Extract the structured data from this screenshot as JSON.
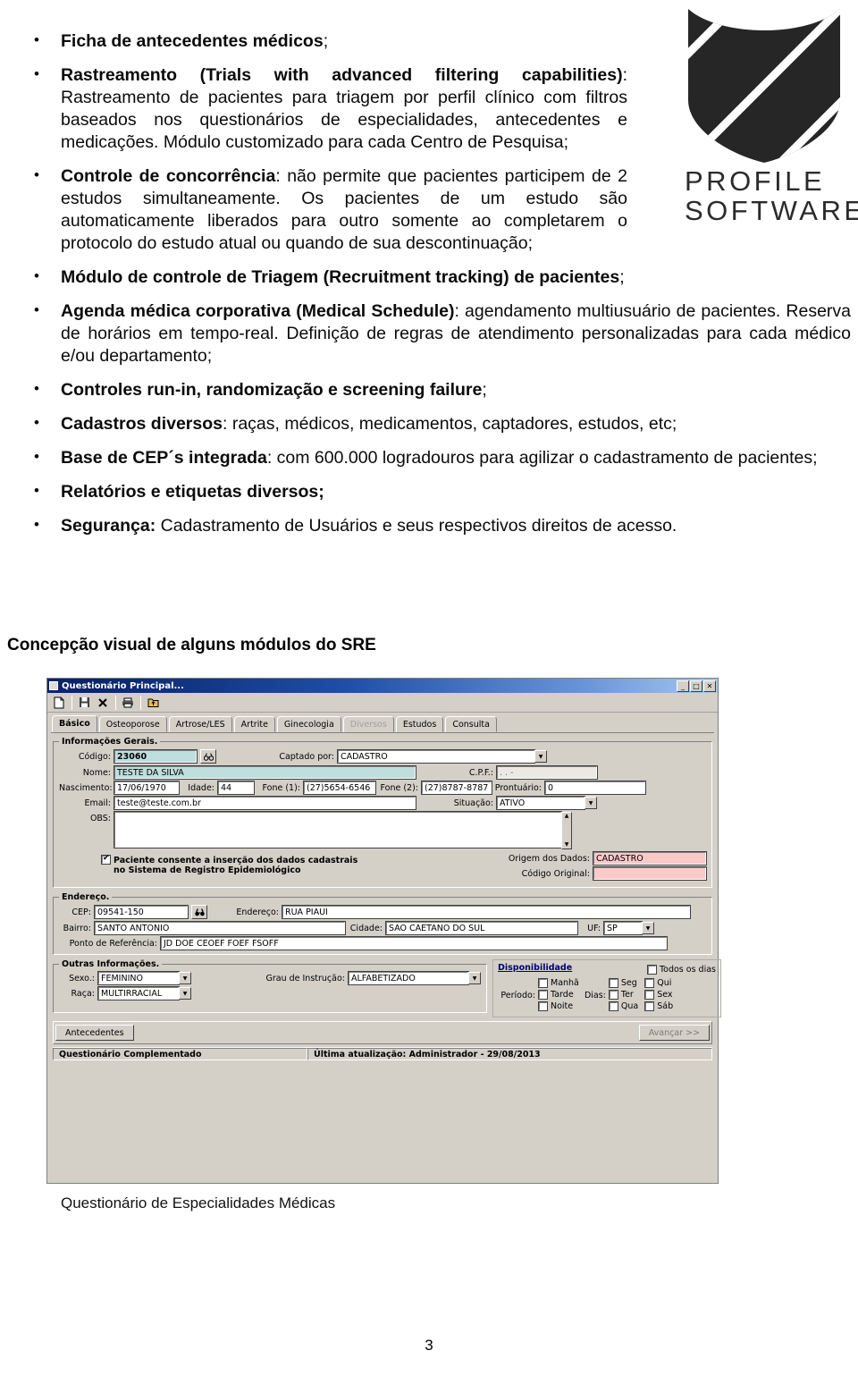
{
  "document": {
    "bullets": [
      {
        "id": "ficha-antecedentes",
        "bold": "Ficha de antecedentes médicos",
        "rest": ";"
      },
      {
        "id": "rastreamento",
        "bold": "Rastreamento (Trials with advanced filtering capabilities)",
        "rest": ": Rastreamento de pacientes para triagem por perfil clínico com filtros baseados nos questionários de especialidades, antecedentes e medicações. Módulo customizado para cada Centro de Pesquisa;"
      },
      {
        "id": "controle-concorrencia",
        "bold": "Controle de concorrência",
        "rest": ": não permite que pacientes participem de 2 estudos simultaneamente. Os pacientes de um estudo são automaticamente liberados para outro somente ao completarem o protocolo do estudo atual ou quando de sua descontinuação;"
      },
      {
        "id": "modulo-triagem",
        "bold": "Módulo de controle de Triagem (Recruitment tracking) de pacientes",
        "rest": ";"
      },
      {
        "id": "agenda-medica",
        "bold": "Agenda médica corporativa (Medical Schedule)",
        "rest": ": agendamento multiusuário de pacientes. Reserva de horários em tempo-real. Definição de regras de atendimento personalizadas para cada médico e/ou departamento;"
      },
      {
        "id": "controles-runin",
        "bold": "Controles run-in, randomização e screening failure",
        "rest": ";"
      },
      {
        "id": "cadastros-diversos",
        "bold": "Cadastros diversos",
        "rest": ": raças, médicos, medicamentos, captadores, estudos, etc;"
      },
      {
        "id": "base-ceps",
        "bold": "Base de CEP´s integrada",
        "rest": ": com 600.000 logradouros para agilizar o cadastramento de pacientes;"
      },
      {
        "id": "relatorios",
        "bold": "Relatórios e etiquetas diversos;",
        "rest": ""
      },
      {
        "id": "seguranca",
        "bold": "Segurança:",
        "rest": " Cadastramento de Usuários e seus respectivos direitos de acesso."
      }
    ],
    "section_heading": "Concepção visual de alguns módulos do SRE",
    "figure_caption": "Questionário de Especialidades Médicas",
    "page_number": "3"
  },
  "logo": {
    "line1": "PROFILE",
    "line2": "SOFTWARE",
    "color": "#262626"
  },
  "app": {
    "title": "Questionário Principal...",
    "window_buttons": {
      "minimize": "_",
      "maximize": "□",
      "close": "✕"
    },
    "toolbar": [
      {
        "name": "new-icon",
        "glyph": "🗋"
      },
      {
        "name": "save-icon",
        "glyph": "💾"
      },
      {
        "name": "delete-icon",
        "glyph": "✕"
      },
      {
        "name": "print-icon",
        "glyph": "🖨"
      },
      {
        "name": "export-icon",
        "glyph": "🗂"
      }
    ],
    "tabs": [
      {
        "label": "Básico",
        "selected": true,
        "disabled": false
      },
      {
        "label": "Osteoporose",
        "selected": false,
        "disabled": false
      },
      {
        "label": "Artrose/LES",
        "selected": false,
        "disabled": false
      },
      {
        "label": "Artrite",
        "selected": false,
        "disabled": false
      },
      {
        "label": "Ginecologia",
        "selected": false,
        "disabled": false
      },
      {
        "label": "Diversos",
        "selected": false,
        "disabled": true
      },
      {
        "label": "Estudos",
        "selected": false,
        "disabled": false
      },
      {
        "label": "Consulta",
        "selected": false,
        "disabled": false
      }
    ],
    "informacoes_gerais": {
      "legend": "Informações Gerais.",
      "codigo_label": "Código:",
      "codigo_value": "23060",
      "search_icon": "binoculars-icon",
      "captado_label": "Captado por:",
      "captado_value": "CADASTRO",
      "nome_label": "Nome:",
      "nome_value": "TESTE DA SILVA",
      "cpf_label": "C.P.F.:",
      "cpf_value": ".    .    -",
      "nascimento_label": "Nascimento:",
      "nascimento_value": "17/06/1970",
      "idade_label": "Idade:",
      "idade_value": "44",
      "fone1_label": "Fone (1):",
      "fone1_value": "(27)5654-6546",
      "fone2_label": "Fone (2):",
      "fone2_value": "(27)8787-8787",
      "prontuario_label": "Prontuário:",
      "prontuario_value": "0",
      "email_label": "Email:",
      "email_value": "teste@teste.com.br",
      "situacao_label": "Situação:",
      "situacao_value": "ATIVO",
      "obs_label": "OBS:",
      "obs_value": "",
      "consent_checked": true,
      "consent_line1": "Paciente consente a inserção dos dados cadastrais",
      "consent_line2": "no Sistema de Registro Epidemiológico",
      "origem_label": "Origem dos Dados:",
      "origem_value": "CADASTRO",
      "codigo_original_label": "Código Original:",
      "codigo_original_value": ""
    },
    "endereco": {
      "legend": "Endereço.",
      "cep_label": "CEP:",
      "cep_value": "09541-150",
      "cep_search_icon": "binoculars-icon",
      "endereco_label": "Endereço:",
      "endereco_value": "RUA PIAUI",
      "bairro_label": "Bairro:",
      "bairro_value": "SANTO ANTONIO",
      "cidade_label": "Cidade:",
      "cidade_value": "SAO CAETANO DO SUL",
      "uf_label": "UF:",
      "uf_value": "SP",
      "ponto_label": "Ponto de Referência:",
      "ponto_value": "JD DOE CEOEF FOEF FSOFF"
    },
    "outras_informacoes": {
      "legend": "Outras Informações.",
      "sexo_label": "Sexo.:",
      "sexo_value": "FEMININO",
      "raca_label": "Raça:",
      "raca_value": "MULTIRRACIAL",
      "grau_label": "Grau de Instrução:",
      "grau_value": "ALFABETIZADO"
    },
    "disponibilidade": {
      "title": "Disponibilidade",
      "todos_os_dias": {
        "label": "Todos os dias",
        "checked": false
      },
      "periodo_label": "Período:",
      "periodos": [
        {
          "label": "Manhã",
          "checked": false
        },
        {
          "label": "Tarde",
          "checked": false
        },
        {
          "label": "Noite",
          "checked": false
        }
      ],
      "dias_label": "Dias:",
      "dias_col1": [
        {
          "label": "Seg",
          "checked": false
        },
        {
          "label": "Ter",
          "checked": false
        },
        {
          "label": "Qua",
          "checked": false
        }
      ],
      "dias_col2": [
        {
          "label": "Qui",
          "checked": false
        },
        {
          "label": "Sex",
          "checked": false
        },
        {
          "label": "Sáb",
          "checked": false
        }
      ]
    },
    "footer": {
      "antecedentes_button": "Antecedentes",
      "avancar_button": "Avançar >>"
    },
    "statusbar": {
      "left": "Questionário Complementado",
      "right": "Última atualização: Administrador - 29/08/2013"
    }
  }
}
